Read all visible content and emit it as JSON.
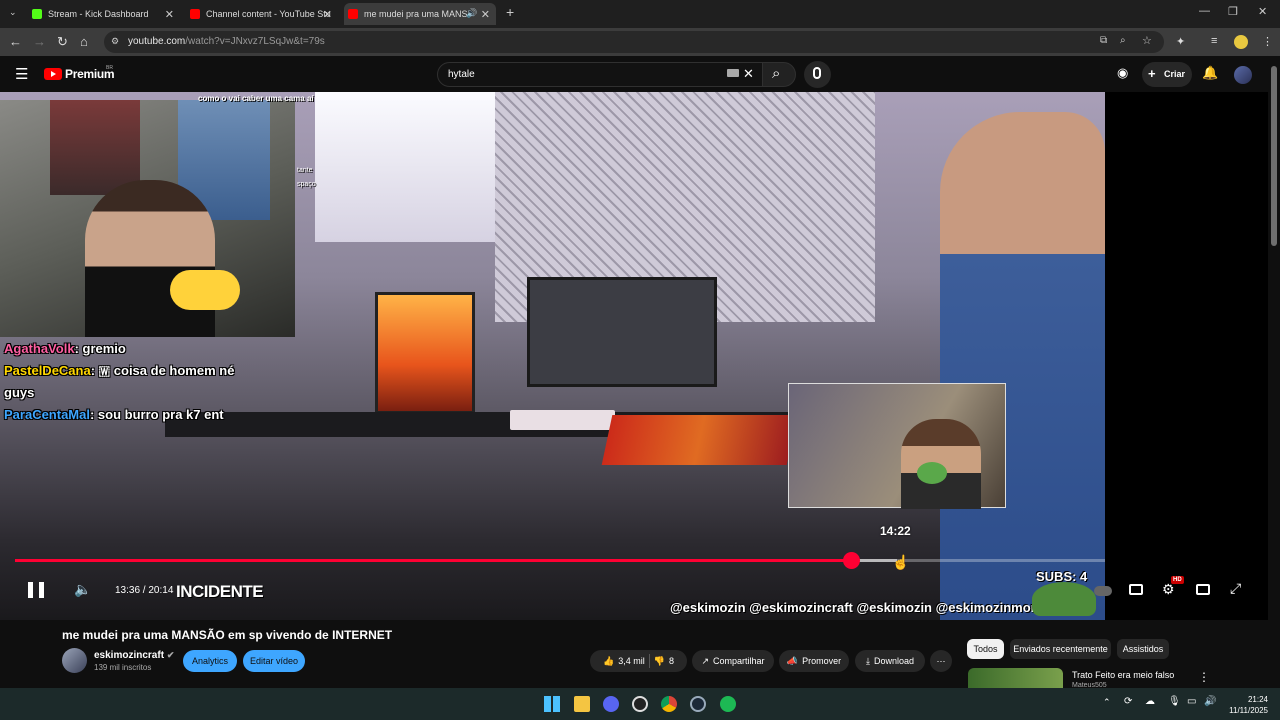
{
  "browser": {
    "tabs": [
      {
        "title": "Stream - Kick Dashboard",
        "icon": "kick-icon"
      },
      {
        "title": "Channel content - YouTube Stu",
        "icon": "youtube-icon"
      },
      {
        "title": "me mudei pra uma MANSÃ",
        "icon": "youtube-icon"
      }
    ],
    "url_main": "youtube.com",
    "url_rest": "/watch?v=JNxvz7LSqJw&t=79s"
  },
  "youtube": {
    "brand": "Premium",
    "country": "BR",
    "search_query": "hytale",
    "create_label": "Criar"
  },
  "player": {
    "webcam_caption": "como o vai caber uma cama aí",
    "side_caption_1": "tante",
    "side_caption_2": "spaço",
    "chat": [
      {
        "user": "AgathaVolk",
        "color": "#ff5fa2",
        "message": ": gremio"
      },
      {
        "user": "PastelDeCana",
        "color": "#ffd700",
        "message": ": 🇼 coisa de homem né"
      },
      {
        "user": "",
        "color": "#ffffff",
        "message": "guys"
      },
      {
        "user": "ParaCentaMal",
        "color": "#3ea6ff",
        "message": ": sou burro pra k7 ent"
      }
    ],
    "current_time": "13:36",
    "duration": "20:14",
    "time_display": "13:36 / 20:14",
    "hover_time": "14:22",
    "progress_fraction": 0.767,
    "buffer_fraction": 0.809,
    "overlay_title": "INCIDENTE",
    "socials": "@eskimozin @eskimozincraft @eskimozin @eskimozinmorreuv",
    "subs_counter": "SUBS: 4",
    "hd_badge": "HD"
  },
  "video": {
    "title": "me mudei pra uma MANSÃO em sp vivendo de INTERNET",
    "channel_name": "eskimozincraft",
    "channel_subs": "139 mil inscritos",
    "analytics_label": "Analytics",
    "edit_label": "Editar vídeo",
    "likes": "3,4 mil",
    "dislikes": "8",
    "share_label": "Compartilhar",
    "promote_label": "Promover",
    "download_label": "Download"
  },
  "recommendations": {
    "chips": [
      "Todos",
      "Enviados recentemente",
      "Assistidos"
    ],
    "first_title": "Trato Feito era meio falso",
    "first_channel": "Mateus505"
  },
  "taskbar": {
    "time": "21:24",
    "date": "11/11/2025"
  }
}
